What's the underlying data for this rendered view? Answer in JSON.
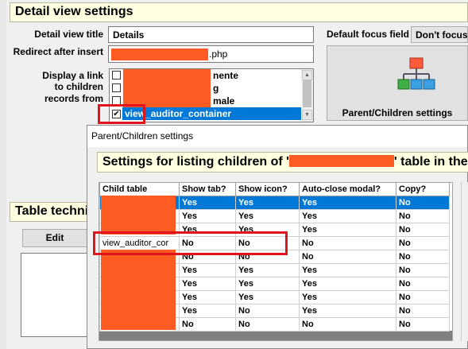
{
  "detail_section": {
    "header": "Detail view settings",
    "title_label": "Detail view title",
    "title_value": "Details",
    "redirect_label": "Redirect after insert",
    "redirect_suffix": ".php",
    "children_label_1": "Display a link",
    "children_label_2": "to children",
    "children_label_3": "records from",
    "list_items": [
      {
        "text": "nente",
        "checked": false
      },
      {
        "text": "g",
        "checked": false
      },
      {
        "text": "male",
        "checked": false
      },
      {
        "text": "view_auditor_container",
        "checked": true,
        "selected": true
      }
    ],
    "focus_label": "Default focus field",
    "focus_value": "Don't focus a",
    "parent_children_button": "Parent/Children settings"
  },
  "table_section": {
    "header": "Table techni",
    "edit_button": "Edit"
  },
  "modal": {
    "title": "Parent/Children settings",
    "banner_prefix": "Settings for listing children of '",
    "banner_suffix": "' table in the d",
    "columns": [
      "Child table",
      "Show tab?",
      "Show icon?",
      "Auto-close modal?",
      "Copy?"
    ],
    "rows": [
      [
        "",
        "Yes",
        "Yes",
        "Yes",
        "No"
      ],
      [
        "",
        "Yes",
        "Yes",
        "Yes",
        "No"
      ],
      [
        "",
        "Yes",
        "Yes",
        "Yes",
        "No"
      ],
      [
        "view_auditor_cor",
        "No",
        "No",
        "No",
        "No"
      ],
      [
        "",
        "No",
        "No",
        "No",
        "No"
      ],
      [
        "",
        "Yes",
        "Yes",
        "Yes",
        "No"
      ],
      [
        "",
        "Yes",
        "Yes",
        "Yes",
        "No"
      ],
      [
        "",
        "Yes",
        "Yes",
        "Yes",
        "No"
      ],
      [
        "",
        "Yes",
        "No",
        "Yes",
        "No"
      ],
      [
        "",
        "No",
        "No",
        "No",
        "No"
      ]
    ]
  },
  "colors": {
    "header_bg": "#ffffe1",
    "redaction": "#ff5c24",
    "highlight_box": "#e0141c",
    "selection": "#0078d7"
  }
}
